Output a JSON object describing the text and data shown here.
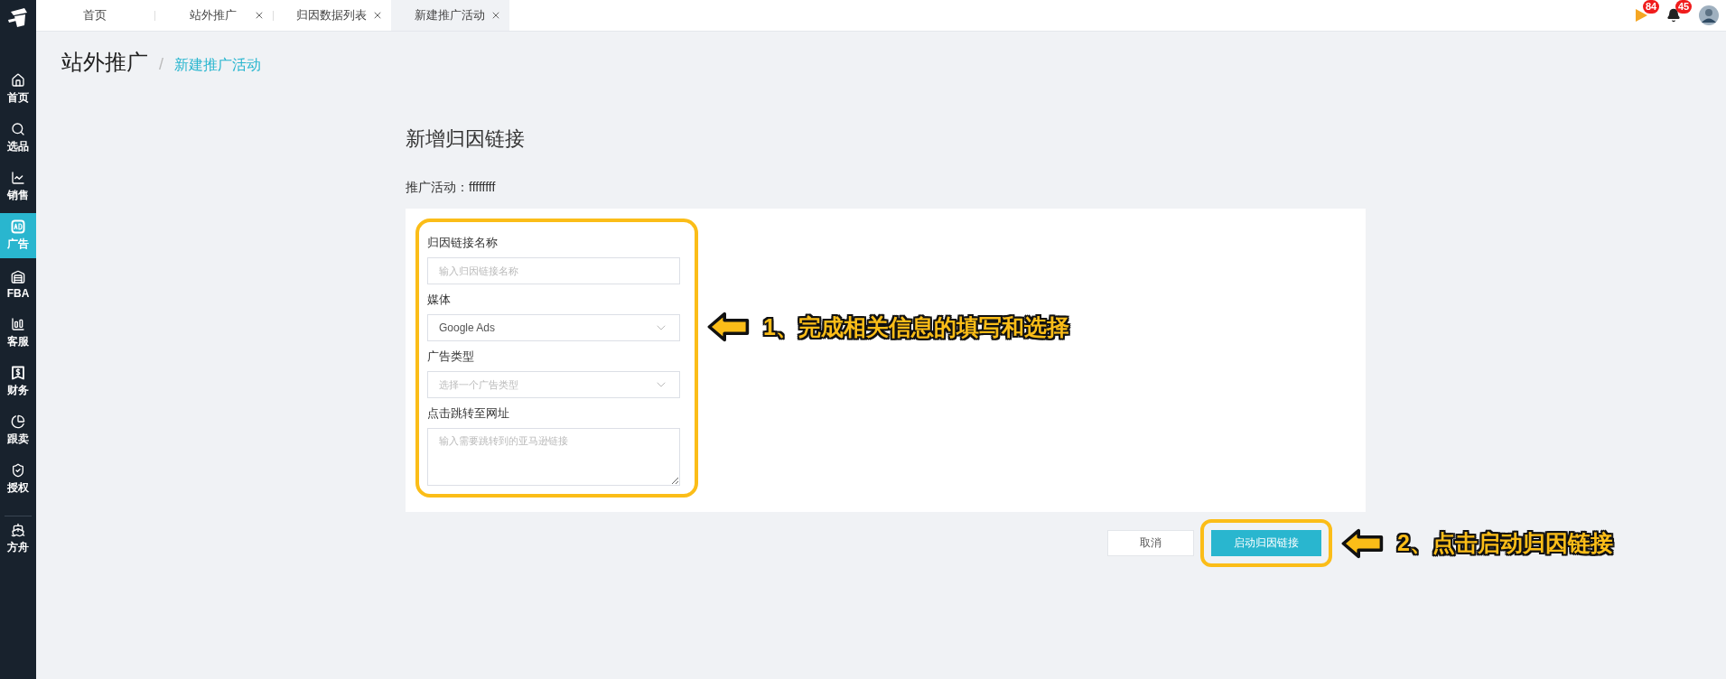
{
  "sidebar": {
    "items": [
      {
        "label": "首页",
        "selected": false
      },
      {
        "label": "选品",
        "selected": false
      },
      {
        "label": "销售",
        "selected": false
      },
      {
        "label": "广告",
        "selected": true
      },
      {
        "label": "FBA",
        "selected": false
      },
      {
        "label": "客服",
        "selected": false
      },
      {
        "label": "财务",
        "selected": false
      },
      {
        "label": "跟卖",
        "selected": false
      },
      {
        "label": "授权",
        "selected": false
      },
      {
        "label": "方舟",
        "selected": false
      }
    ]
  },
  "tabs": [
    {
      "label": "首页",
      "closable": false,
      "selected": false
    },
    {
      "label": "站外推广",
      "closable": true,
      "selected": false
    },
    {
      "label": "归因数据列表",
      "closable": true,
      "selected": false
    },
    {
      "label": "新建推广活动",
      "closable": true,
      "selected": true
    }
  ],
  "notifications": [
    {
      "kind": "flag",
      "count": "84"
    },
    {
      "kind": "bell",
      "count": "45"
    }
  ],
  "breadcrumb": {
    "title": "站外推广",
    "separator": "/",
    "current": "新建推广活动"
  },
  "form": {
    "title": "新增归因链接",
    "campaign": "推广活动：ffffffff",
    "fields": [
      {
        "kind": "input",
        "label": "归因链接名称",
        "placeholder": "输入归因链接名称"
      },
      {
        "kind": "select",
        "label": "媒体",
        "value": "Google Ads"
      },
      {
        "kind": "select",
        "label": "广告类型",
        "placeholder": "选择一个广告类型"
      },
      {
        "kind": "textarea",
        "label": "点击跳转至网址",
        "placeholder": "输入需要跳转到的亚马逊链接"
      }
    ]
  },
  "buttons": [
    {
      "label": "取消",
      "kind": "secondary"
    },
    {
      "label": "启动归因链接",
      "kind": "primary"
    }
  ],
  "annotations": [
    {
      "text": "1、完成相关信息的填写和选择"
    },
    {
      "text": "2、点击启动归因链接"
    }
  ]
}
